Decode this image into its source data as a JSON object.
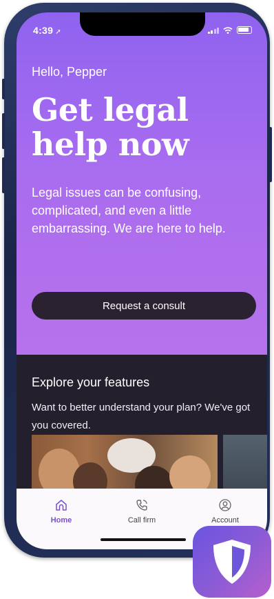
{
  "status_bar": {
    "time": "4:39"
  },
  "hero": {
    "greeting": "Hello, Pepper",
    "headline_line1": "Get legal",
    "headline_line2": "help now",
    "subtitle": "Legal issues can be confusing, complicated, and even a little embarrassing. We are here to help.",
    "cta_label": "Request a consult"
  },
  "explore": {
    "title": "Explore your features",
    "description": "Want to better understand your plan? We've got you covered."
  },
  "tabbar": {
    "items": [
      {
        "label": "Home",
        "icon": "home-icon",
        "active": true
      },
      {
        "label": "Call firm",
        "icon": "phone-icon",
        "active": false
      },
      {
        "label": "Account",
        "icon": "user-icon",
        "active": false
      }
    ]
  },
  "colors": {
    "hero_top": "#8f63ef",
    "hero_bottom": "#b772ec",
    "cta_bg": "#2b2231",
    "dark_section": "#241f2c",
    "tab_active": "#7a4fc9"
  },
  "app_icon": {
    "icon": "shield-icon"
  }
}
